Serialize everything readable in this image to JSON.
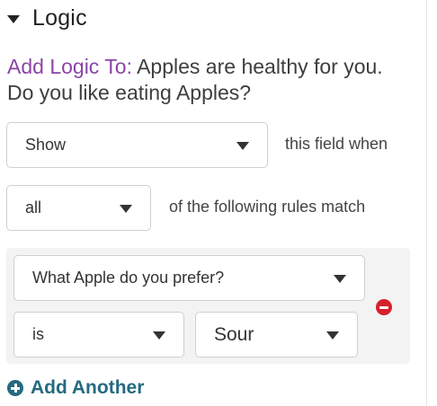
{
  "section": {
    "title": "Logic"
  },
  "heading": {
    "prefix": "Add Logic To:",
    "question": "Apples are healthy for you. Do you like eating Apples?"
  },
  "action_row": {
    "action_value": "Show",
    "trailing_text": "this field when"
  },
  "match_row": {
    "match_value": "all",
    "trailing_text": "of the following rules match"
  },
  "rules": [
    {
      "field": "What Apple do you prefer?",
      "operator": "is",
      "value": "Sour"
    }
  ],
  "footer": {
    "add_label": "Add Another"
  },
  "colors": {
    "accent_purple": "#8a45a6",
    "link_teal": "#246a80",
    "remove_red": "#d3212c",
    "rule_bg": "#f3f3f3"
  },
  "icons": {
    "collapse": "caret-down-icon",
    "dropdown": "chevron-down-icon",
    "remove": "minus-circle-icon",
    "add": "plus-circle-icon"
  }
}
